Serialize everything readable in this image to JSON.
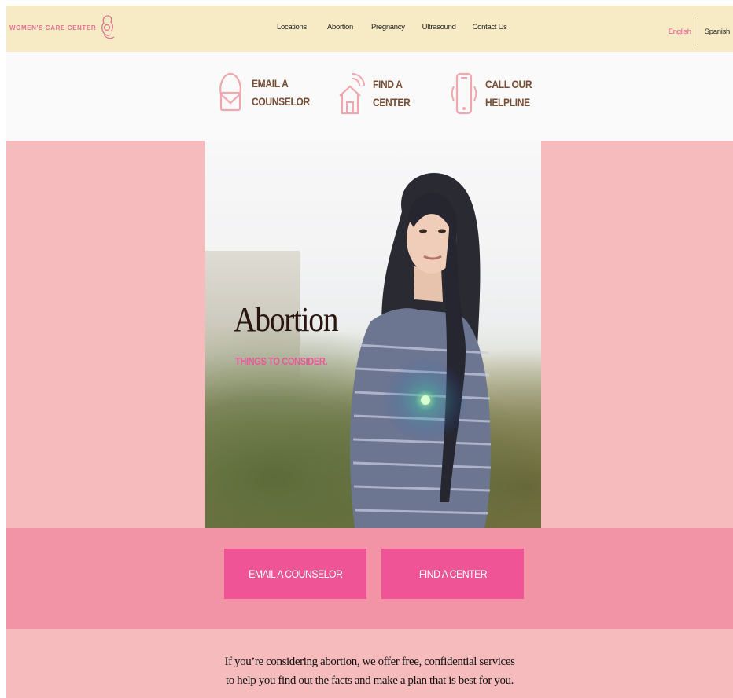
{
  "header": {
    "logo_text": "WOMEN'S CARE CENTER",
    "nav": [
      "Locations",
      "Abortion",
      "Pregnancy",
      "Ultrasound",
      "Contact Us"
    ],
    "languages": {
      "english": "English",
      "spanish": "Spanish",
      "active": "English"
    }
  },
  "quick_actions": [
    {
      "line1": "EMAIL A",
      "line2": "COUNSELOR",
      "icon": "email-counselor-icon"
    },
    {
      "line1": "FIND A",
      "line2": "CENTER",
      "icon": "house-icon"
    },
    {
      "line1": "CALL OUR",
      "line2": "HELPLINE",
      "icon": "phone-icon"
    }
  ],
  "hero": {
    "title": "Abortion",
    "subtitle": "THINGS TO CONSIDER."
  },
  "cta": {
    "email_button": "EMAIL A COUNSELOR",
    "find_button": "FIND A CENTER"
  },
  "intro": {
    "line1": "If you’re considering abortion, we offer free, confidential services",
    "line2": "to help you find out the facts and make a plan that is best for you."
  },
  "colors": {
    "header_bg": "#f7ebc5",
    "accent_pink": "#ee5496",
    "hero_bg": "#f6bcbd",
    "cta_band": "#f393a6",
    "icon_pink": "#f0a8ae",
    "action_text": "#7a4e36"
  }
}
